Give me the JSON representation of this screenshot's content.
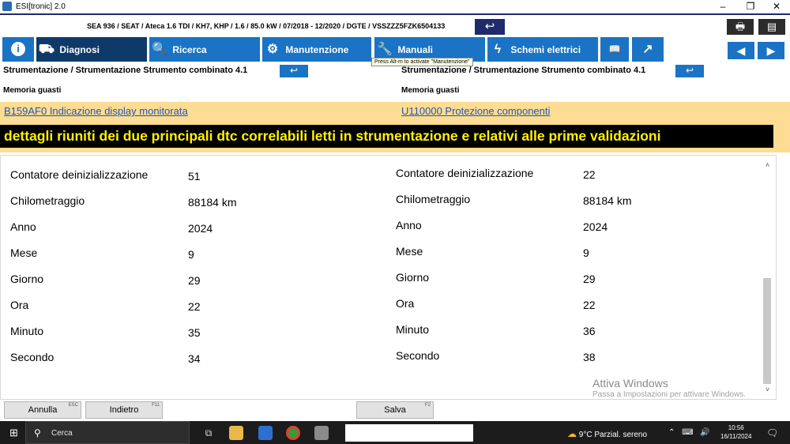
{
  "window": {
    "title": "ESI[tronic] 2.0",
    "minimize": "–",
    "restore": "❐",
    "close": "✕"
  },
  "vehicle": {
    "info": "SEA 936 / SEAT / Ateca 1.6 TDI / KH7, KHP / 1.6 / 85.0 kW / 07/2018 - 12/2020 / DGTE / VSSZZZ5FZK6504133",
    "back_icon": "↩",
    "print_icon": "🖶",
    "add_icon": "▤"
  },
  "nav": {
    "info_icon": "i",
    "diagnosi": {
      "label": "Diagnosi",
      "icon": "⛟"
    },
    "ricerca": {
      "label": "Ricerca",
      "icon": "🔍"
    },
    "manutenzione": {
      "label": "Manutenzione",
      "icon": "⚙"
    },
    "manuali": {
      "label": "Manuali",
      "icon": "🔧"
    },
    "schemi": {
      "label": "Schemi elettrici",
      "icon": "ϟ"
    },
    "book_icon": "📖",
    "external_icon": "↗",
    "prev_icon": "◀",
    "next_icon": "▶",
    "tooltip": "Press Alt-m to activate \"Manutenzione\""
  },
  "left": {
    "breadcrumb": "Strumentazione / Strumentazione Strumento combinato 4.1",
    "back_icon": "↩",
    "section": "Memoria guasti",
    "dtc": "B159AF0 Indicazione display monitorata",
    "fields": [
      {
        "label": "Contatore deinizializzazione",
        "value": "51"
      },
      {
        "label": "Chilometraggio",
        "value": "88184 km"
      },
      {
        "label": "Anno",
        "value": "2024"
      },
      {
        "label": "Mese",
        "value": "9"
      },
      {
        "label": "Giorno",
        "value": "29"
      },
      {
        "label": "Ora",
        "value": "22"
      },
      {
        "label": "Minuto",
        "value": "35"
      },
      {
        "label": "Secondo",
        "value": "34"
      }
    ]
  },
  "right": {
    "breadcrumb": "Strumentazione / Strumentazione Strumento combinato 4.1",
    "back_icon": "↩",
    "section": "Memoria guasti",
    "dtc": "U110000 Protezione componenti",
    "fields": [
      {
        "label": "Contatore deinizializzazione",
        "value": "22"
      },
      {
        "label": "Chilometraggio",
        "value": "88184 km"
      },
      {
        "label": "Anno",
        "value": "2024"
      },
      {
        "label": "Mese",
        "value": "9"
      },
      {
        "label": "Giorno",
        "value": "29"
      },
      {
        "label": "Ora",
        "value": "22"
      },
      {
        "label": "Minuto",
        "value": "36"
      },
      {
        "label": "Secondo",
        "value": "38"
      }
    ]
  },
  "banner": "dettagli riuniti dei due principali dtc correlabili letti in strumentazione e relativi alle prime validazioni",
  "watermark": {
    "title": "Attiva Windows",
    "subtitle": "Passa a Impostazioni per attivare Windows."
  },
  "scroll": {
    "up": "˄",
    "down": "˅"
  },
  "buttons": {
    "annulla": {
      "label": "Annulla",
      "key": "ESC"
    },
    "indietro": {
      "label": "Indietro",
      "key": "F11"
    },
    "salva": {
      "label": "Salva",
      "key": "F2"
    }
  },
  "taskbar": {
    "start_icon": "⊞",
    "search_icon": "⚲",
    "search_placeholder": "Cerca",
    "taskview_icon": "⧉",
    "weather": "9°C  Parzial. sereno",
    "weather_icon": "☁",
    "tray_icons": "⌃ ⌨ 🔊",
    "time": "10:56",
    "date": "16/11/2024",
    "notification_icon": "🗨"
  },
  "colors": {
    "nav_blue": "#1a73c4",
    "nav_active": "#0e3a6a",
    "banner_text": "#fff200",
    "highlight_band": "#fddc93",
    "link": "#1e56b8"
  }
}
